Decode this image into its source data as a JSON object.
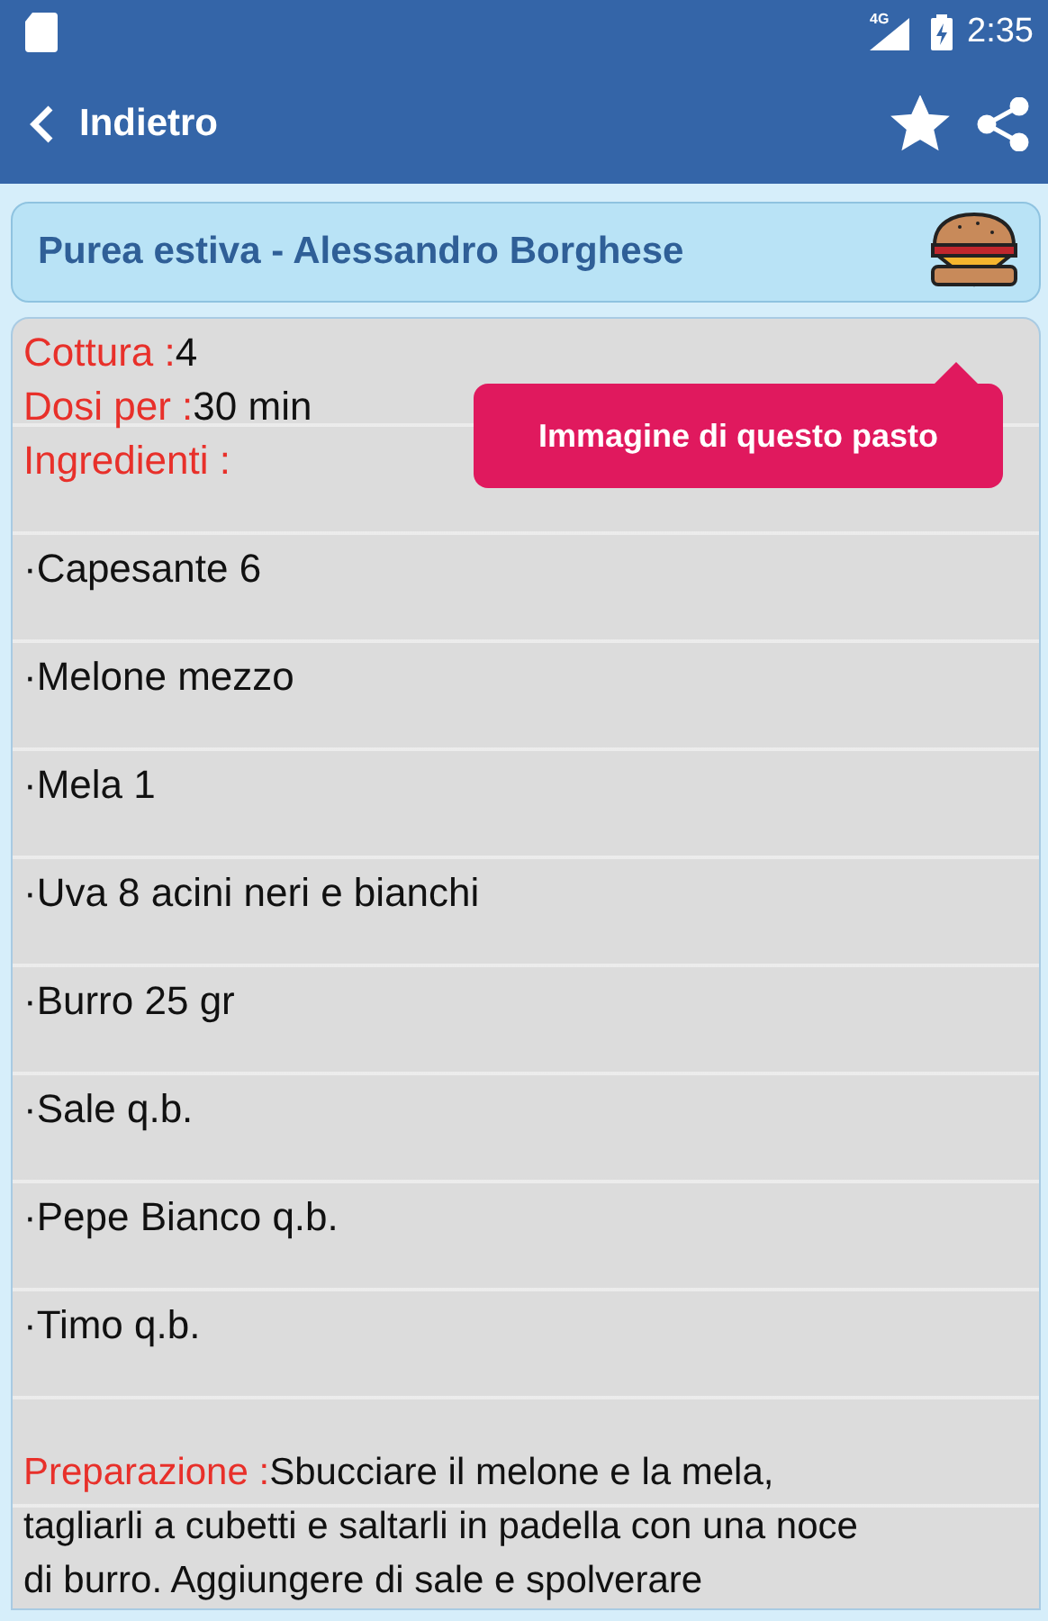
{
  "status_bar": {
    "network": "4G",
    "time": "2:35"
  },
  "app_bar": {
    "back_label": "Indietro",
    "favorite": true
  },
  "recipe_title": "Purea estiva - Alessandro Borghese",
  "details": [
    {
      "label": "Cottura :",
      "value": "4"
    },
    {
      "label": "Dosi per :",
      "value": "30 min"
    },
    {
      "label": "Ingredienti :"
    }
  ],
  "tooltip": "Immagine di questo pasto",
  "ingredients": [
    "·Capesante 6",
    "·Melone mezzo",
    "·Mela 1",
    "·Uva 8 acini neri e bianchi",
    "·Burro 25 gr",
    "·Sale q.b.",
    "·Pepe Bianco q.b.",
    "·Timo q.b."
  ],
  "preparation": {
    "label": "Preparazione :",
    "text": "Sbucciare il melone e la mela, tagliarli a cubetti e saltarli in padella con una noce di burro. Aggiungere di sale e spolverare"
  }
}
